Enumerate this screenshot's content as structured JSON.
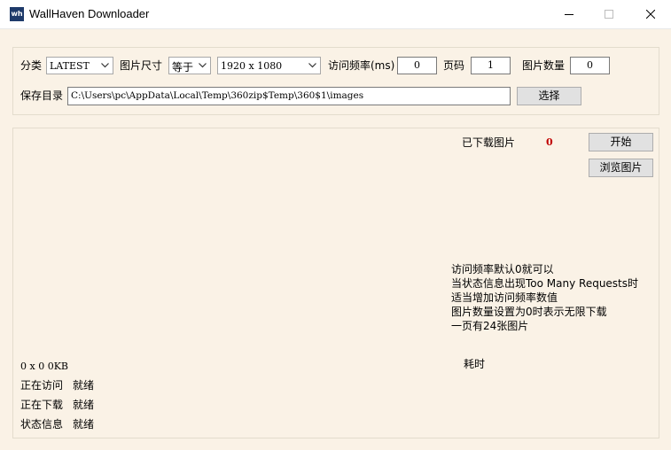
{
  "window": {
    "title": "WallHaven Downloader",
    "icon_text": "wh"
  },
  "controls": {
    "category_label": "分类",
    "category_value": "LATEST",
    "size_label": "图片尺寸",
    "size_operator_value": "等于",
    "resolution_value": "1920 x 1080",
    "rate_label": "访问频率(ms)",
    "rate_value": "0",
    "page_label": "页码",
    "page_value": "1",
    "count_label": "图片数量",
    "count_value": "0",
    "save_dir_label": "保存目录",
    "save_dir_value": "C:\\Users\\pc\\AppData\\Local\\Temp\\360zip$Temp\\360$1\\images",
    "choose_button": "选择"
  },
  "main": {
    "downloaded_label": "已下载图片",
    "downloaded_count": "0",
    "start_button": "开始",
    "browse_button": "浏览图片",
    "tips": [
      "访问频率默认0就可以",
      "当状态信息出现Too Many Requests时",
      "适当增加访问频率数值",
      "图片数量设置为0时表示无限下载",
      "一页有24张图片"
    ],
    "elapsed_label": "耗时",
    "size_info": "0 x 0 0KB",
    "status_rows": [
      {
        "label": "正在访问",
        "value": "就绪"
      },
      {
        "label": "正在下载",
        "value": "就绪"
      },
      {
        "label": "状态信息",
        "value": "就绪"
      }
    ]
  },
  "colors": {
    "background": "#faf2e6",
    "count_accent": "#c00000",
    "icon_bg": "#1e3a6a"
  },
  "icons": [
    "app-icon",
    "minimize-icon",
    "maximize-icon",
    "close-icon",
    "chevron-down-icon"
  ]
}
